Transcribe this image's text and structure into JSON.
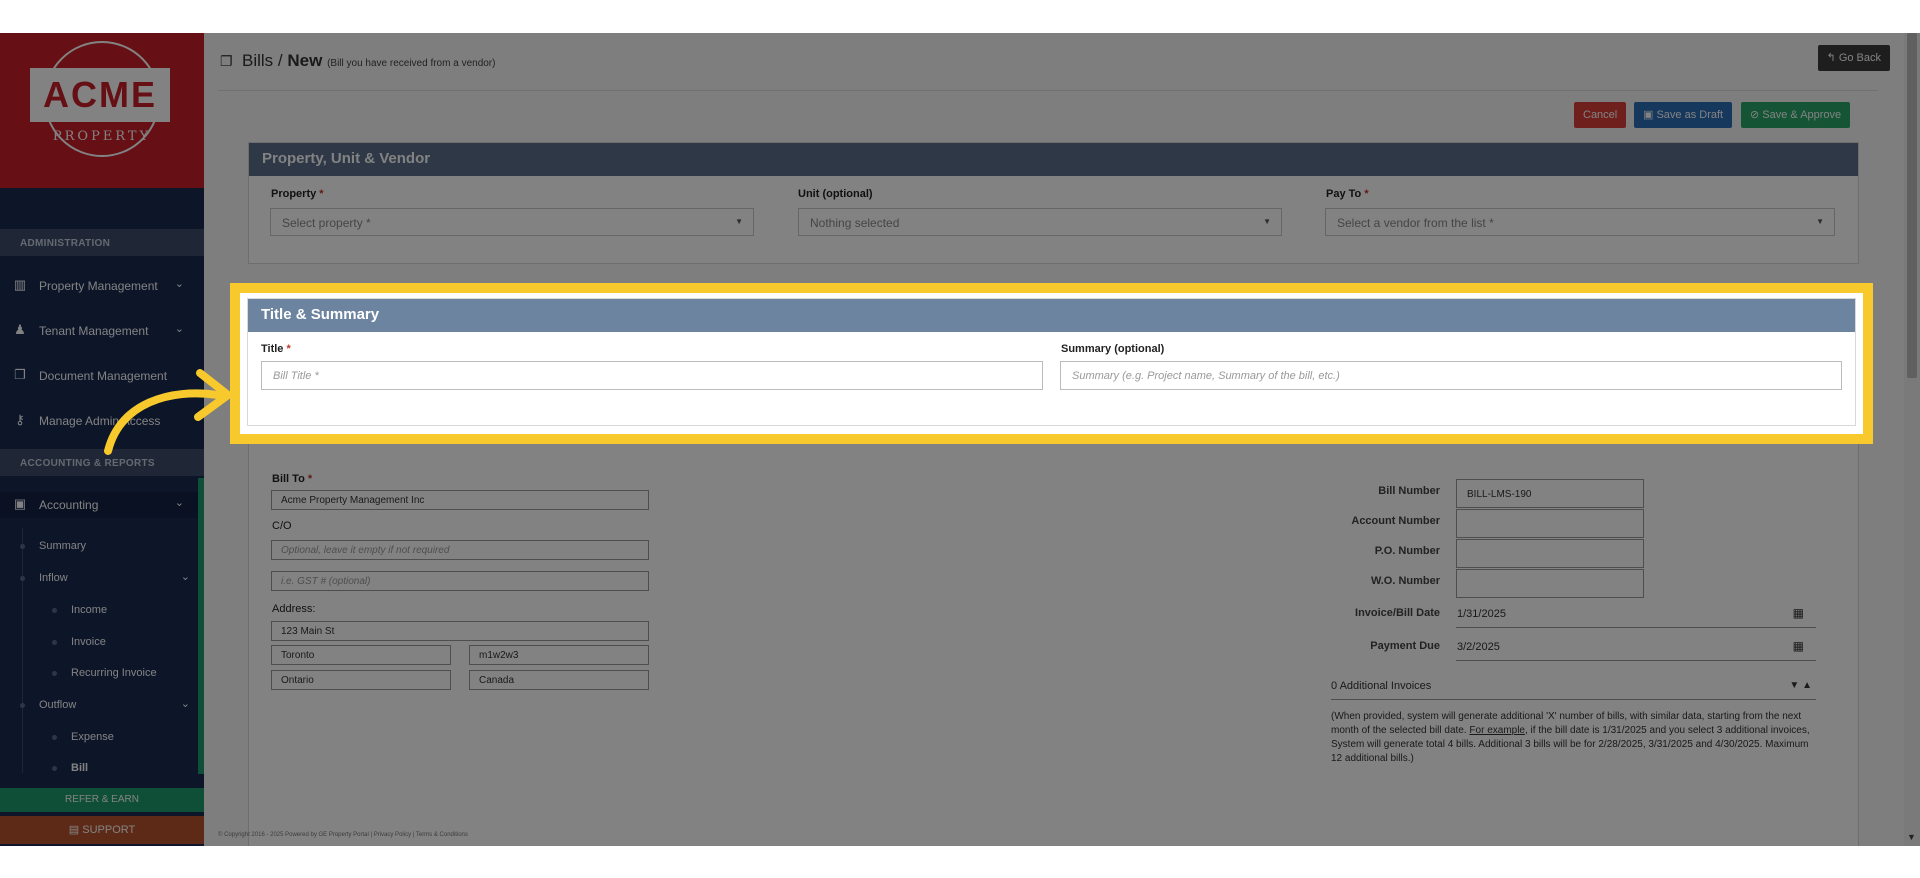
{
  "sidebar": {
    "logo_text": "ACME",
    "logo_sub": "PROPERTY",
    "sections": {
      "administration": "ADMINISTRATION",
      "accounting_reports": "ACCOUNTING & REPORTS"
    },
    "admin_items": [
      {
        "label": "Property Management",
        "icon": "building-icon"
      },
      {
        "label": "Tenant Management",
        "icon": "users-icon"
      },
      {
        "label": "Document Management",
        "icon": "documents-icon"
      },
      {
        "label": "Manage Admin Access",
        "icon": "keys-icon"
      }
    ],
    "accounting_label": "Accounting",
    "accounting_sub": {
      "summary": "Summary",
      "inflow": "Inflow",
      "income": "Income",
      "invoice": "Invoice",
      "recurring_invoice": "Recurring Invoice",
      "outflow": "Outflow",
      "expense": "Expense",
      "bill": "Bill"
    },
    "refer": "REFER & EARN",
    "support": "SUPPORT"
  },
  "header": {
    "title": "Bills /",
    "title_new": "New",
    "subtitle": "(Bill you have received from a vendor)",
    "go_back": "Go Back"
  },
  "actions": {
    "cancel": "Cancel",
    "save_draft": "Save as Draft",
    "save_approve": "Save & Approve"
  },
  "puv": {
    "heading": "Property, Unit & Vendor",
    "property_label": "Property",
    "property_placeholder": "Select property *",
    "unit_label": "Unit (optional)",
    "unit_value": "Nothing selected",
    "payto_label": "Pay To",
    "payto_placeholder": "Select a vendor from the list *"
  },
  "title_summary": {
    "heading": "Title & Summary",
    "title_label": "Title",
    "title_placeholder": "Bill Title *",
    "summary_label": "Summary (optional)",
    "summary_placeholder": "Summary (e.g. Project name, Summary of the bill, etc.)"
  },
  "billto": {
    "label": "Bill To",
    "name": "Acme Property Management Inc",
    "co_label": "C/O",
    "co_placeholder": "Optional, leave it empty if not required",
    "gst_placeholder": "i.e. GST # (optional)",
    "address_label": "Address:",
    "street": "123 Main St",
    "city": "Toronto",
    "postal": "m1w2w3",
    "province": "Ontario",
    "country": "Canada"
  },
  "bill_details": {
    "bill_number_label": "Bill Number",
    "bill_number": "BILL-LMS-190",
    "account_number_label": "Account Number",
    "po_number_label": "P.O. Number",
    "wo_number_label": "W.O. Number",
    "invoice_date_label": "Invoice/Bill Date",
    "invoice_date": "1/31/2025",
    "payment_due_label": "Payment Due",
    "payment_due": "3/2/2025",
    "additional_invoices": "0 Additional Invoices",
    "note_a": "(When provided, system will generate additional 'X' number of bills, with similar data, starting from the next month of the selected bill date. ",
    "note_link": "For example",
    "note_b": ", if the bill date is 1/31/2025 and you select 3 additional invoices, System will generate total 4 bills. Additional 3 bills will be for 2/28/2025, 3/31/2025 and 4/30/2025. Maximum 12 additional bills.)"
  },
  "footer": "© Copyright 2016 - 2025 Powered by GE Property Portal | Privacy Policy | Terms & Conditions",
  "colors": {
    "highlight": "#f7c92c",
    "card_header": "#5a6f8a",
    "brand_red": "#c8202a",
    "sidebar": "#1a2a52"
  }
}
